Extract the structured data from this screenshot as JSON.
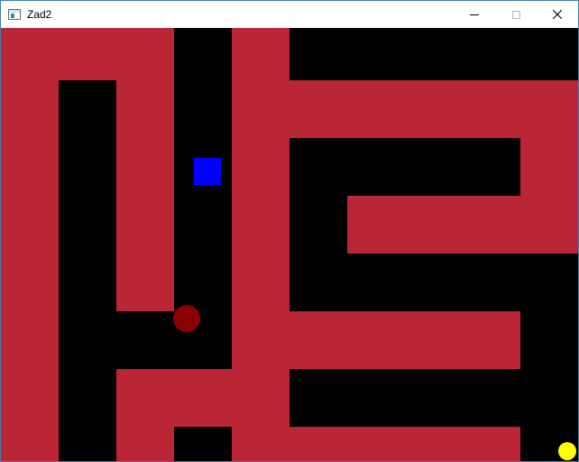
{
  "window": {
    "title": "Zad2",
    "border_color": "#3c7fb1"
  },
  "titlebar": {
    "app_icon": "window-app-icon",
    "minimize_icon": "minimize-icon",
    "maximize_icon": "maximize-icon",
    "close_icon": "close-icon"
  },
  "game": {
    "background_color": "#000000",
    "wall_color": "#ba2636",
    "player": {
      "shape": "square",
      "color": "#0000ff"
    },
    "enemy": {
      "shape": "circle",
      "color": "#8b0000"
    },
    "goal": {
      "shape": "circle",
      "color": "#ffff00"
    }
  }
}
